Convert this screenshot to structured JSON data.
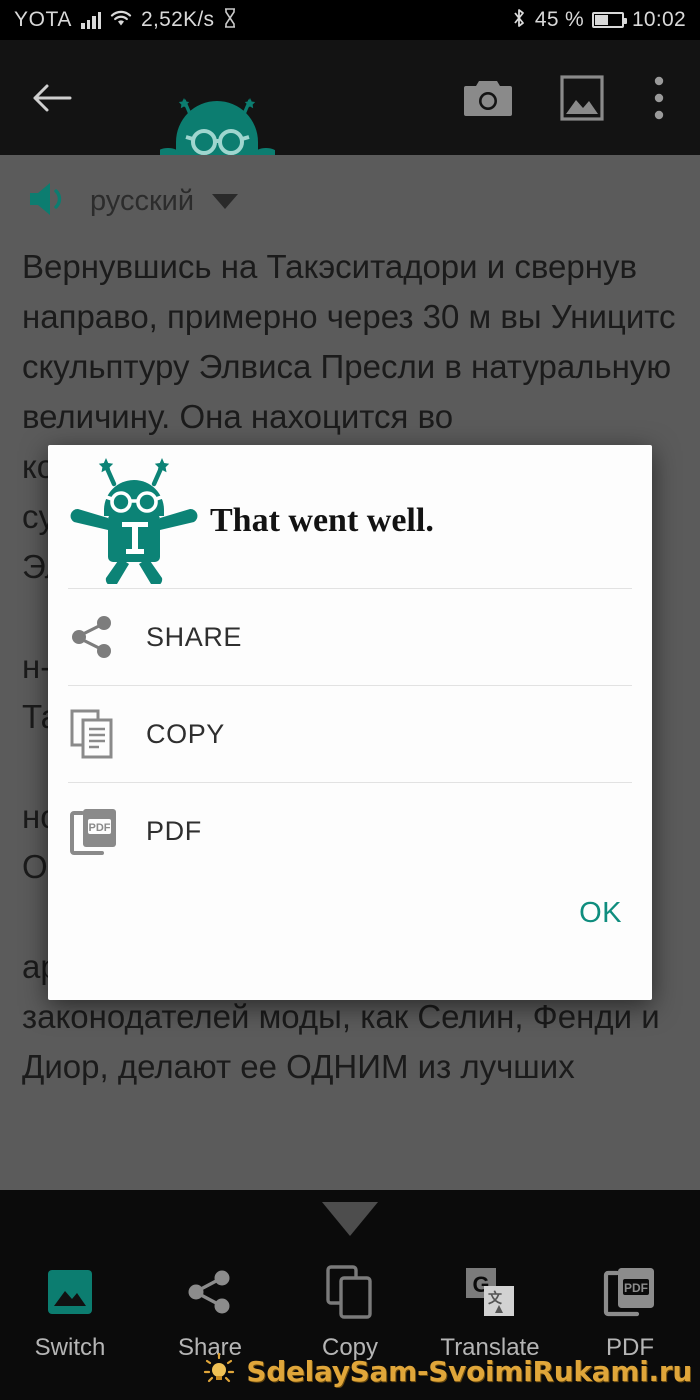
{
  "statusbar": {
    "carrier": "YOTA",
    "signal_icon": "signal-bars-icon",
    "wifi_icon": "wifi-icon",
    "data_rate": "2,52K/s",
    "hourglass_icon": "hourglass-icon",
    "bluetooth_icon": "bluetooth-icon",
    "battery_percent": "45 %",
    "battery_icon": "battery-icon",
    "clock": "10:02"
  },
  "toolbar": {
    "back_icon": "arrow-left-icon",
    "mascot_icon": "robot-mascot-icon",
    "camera_icon": "camera-icon",
    "gallery_icon": "image-icon",
    "overflow_icon": "more-vertical-icon"
  },
  "content": {
    "speaker_icon": "speaker-icon",
    "language": "русский",
    "dropdown_icon": "chevron-down-icon",
    "text": "Вернувшись на Такэситадори и свернув направо, примерно через 30 м вы Уницитс скульптуру Элвиса Пресли в натуральную величину. Она нахоцится во\nко\nсу\nЭл\n\nн-\nТа\n\nно\nОм\n\nары с множеством , бутиков таких законодателей моды, как Селин, Фенди и Диор, делают ее ОДНИМ из лучших"
  },
  "dialog": {
    "mascot_icon": "robot-mascot-icon",
    "title": "That went well.",
    "rows": [
      {
        "label": "SHARE",
        "icon": "share-icon"
      },
      {
        "label": "COPY",
        "icon": "copy-icon"
      },
      {
        "label": "PDF",
        "icon": "pdf-icon"
      }
    ],
    "ok_label": "OK"
  },
  "bottombar": {
    "collapse_icon": "chevron-down-icon",
    "items": [
      {
        "label": "Switch",
        "icon": "image-switch-icon"
      },
      {
        "label": "Share",
        "icon": "share-icon"
      },
      {
        "label": "Copy",
        "icon": "copy-icon"
      },
      {
        "label": "Translate",
        "icon": "google-translate-icon"
      },
      {
        "label": "PDF",
        "icon": "pdf-icon"
      }
    ]
  },
  "watermark": {
    "bulb_icon": "lightbulb-icon",
    "text": "SdelaySam-SvoimiRukami.ru"
  },
  "colors": {
    "accent_teal": "#0f8d7e",
    "status_bg": "#000000",
    "toolbar_bg": "#131313",
    "content_bg": "#5b5b5b",
    "dialog_bg": "#fdfdfd",
    "bottombar_bg": "#0b0b0b",
    "watermark_gold": "#e0a63a"
  }
}
